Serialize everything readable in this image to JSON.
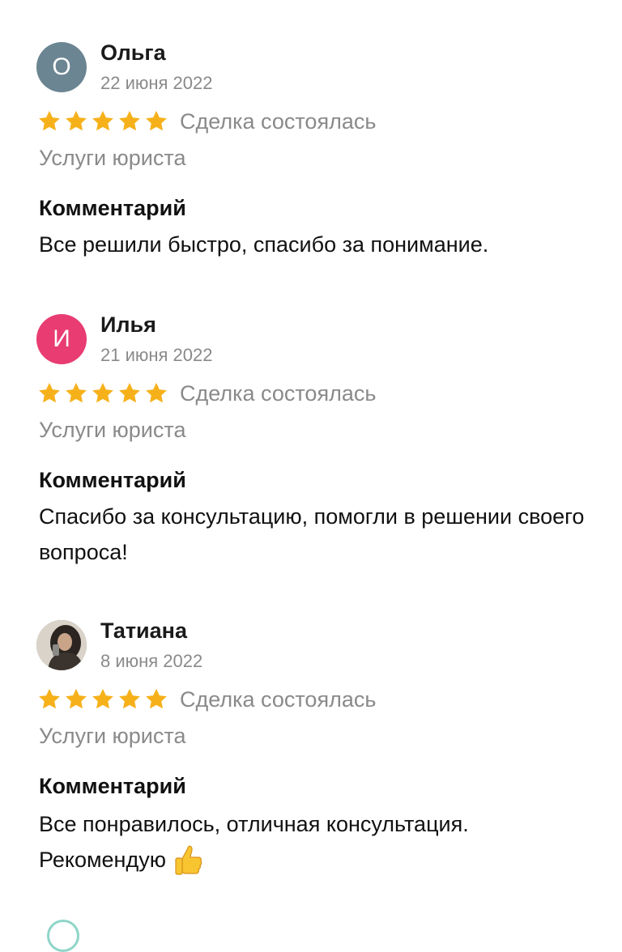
{
  "reviews": [
    {
      "avatar_letter": "О",
      "avatar_color": "#6b8592",
      "author": "Ольга",
      "date": "22 июня 2022",
      "rating": 5,
      "deal_status": "Сделка состоялась",
      "service": "Услуги юриста",
      "comment_heading": "Комментарий",
      "comment": "Все решили быстро, спасибо за понимание."
    },
    {
      "avatar_letter": "И",
      "avatar_color": "#e83c72",
      "author": "Илья",
      "date": "21 июня 2022",
      "rating": 5,
      "deal_status": "Сделка состоялась",
      "service": "Услуги юриста",
      "comment_heading": "Комментарий",
      "comment": "Спасибо за консультацию, помогли в решении своего вопроса!"
    },
    {
      "avatar_letter": "",
      "avatar_color": "#4a4440",
      "author": "Татиана",
      "date": "8 июня 2022",
      "rating": 5,
      "deal_status": "Сделка состоялась",
      "service": "Услуги юриста",
      "comment_heading": "Комментарий",
      "comment": "Все понравилось, отличная консультация. Рекомендую",
      "comment_emoji": "thumbs-up-icon"
    }
  ],
  "colors": {
    "star": "#f6b11a",
    "muted_text": "#8a8a8a",
    "text": "#111111"
  }
}
